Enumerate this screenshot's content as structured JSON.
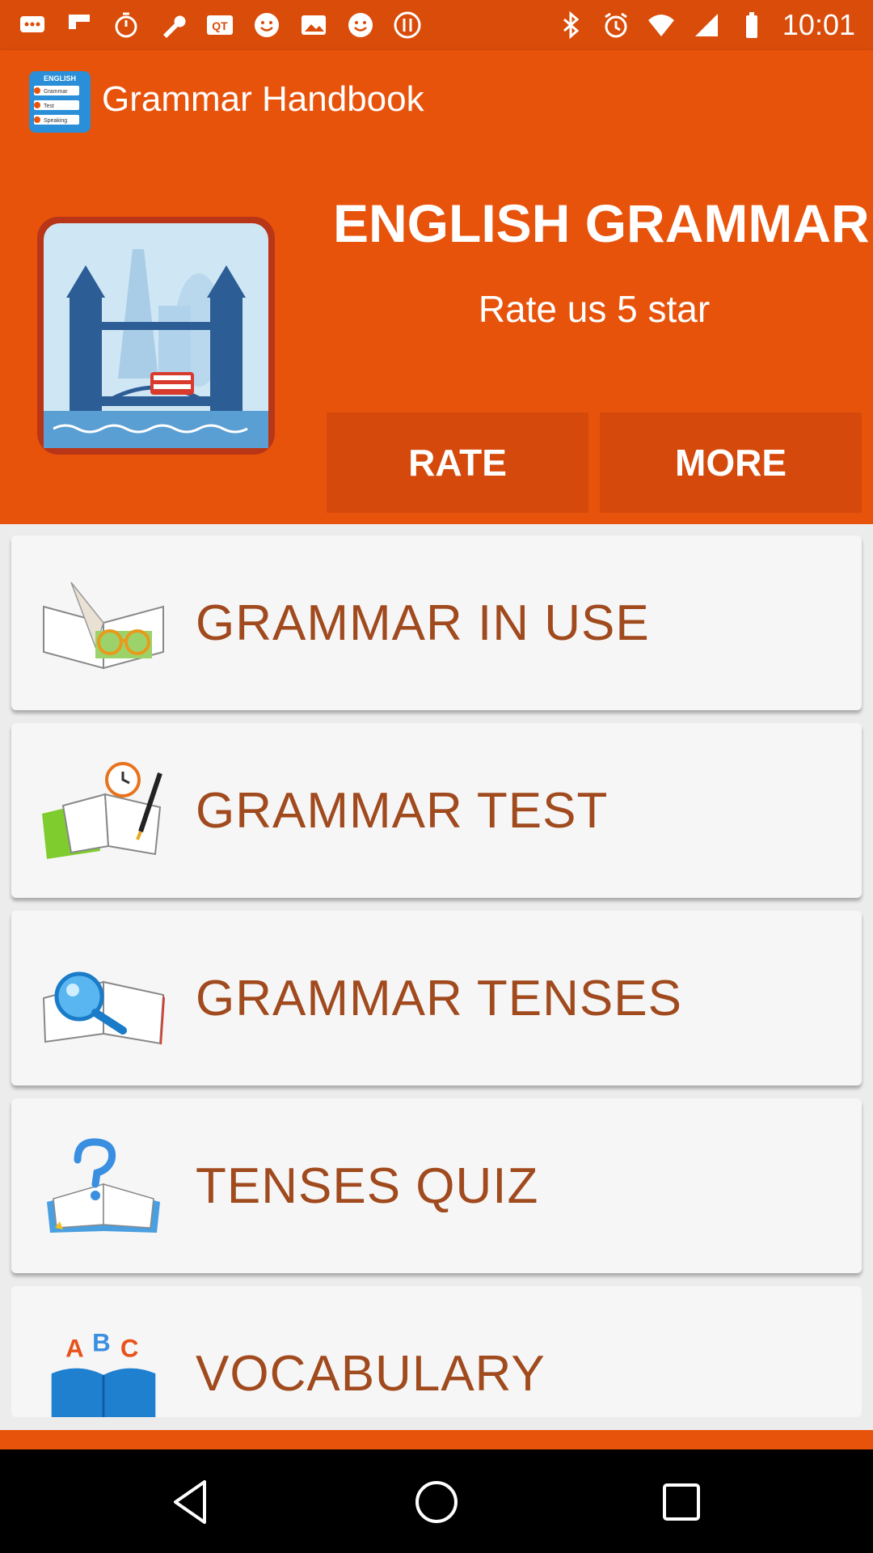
{
  "status_bar": {
    "time": "10:01",
    "left_icons": [
      "messages-icon",
      "flipboard-icon",
      "timer-icon",
      "wrench-icon",
      "qr-app-icon",
      "emoji-icon",
      "image-icon",
      "emoji-icon",
      "data-icon"
    ],
    "right_icons": [
      "bluetooth-icon",
      "alarm-icon",
      "wifi-icon",
      "signal-icon",
      "battery-icon"
    ]
  },
  "app_bar": {
    "title": "Grammar Handbook",
    "logo": {
      "heading": "ENGLISH",
      "lines": [
        "Grammar",
        "Test",
        "Speaking"
      ]
    }
  },
  "banner": {
    "title": "ENGLISH GRAMMAR",
    "subtitle": "Rate us 5 star",
    "rate_label": "RATE",
    "more_label": "MORE"
  },
  "menu": [
    {
      "label": "GRAMMAR IN USE",
      "icon": "book-glasses-icon"
    },
    {
      "label": "GRAMMAR TEST",
      "icon": "book-clock-pen-icon"
    },
    {
      "label": "GRAMMAR TENSES",
      "icon": "book-magnifier-icon"
    },
    {
      "label": "TENSES QUIZ",
      "icon": "book-question-icon"
    },
    {
      "label": "VOCABULARY",
      "icon": "abc-book-icon",
      "icon_text": "ABC"
    }
  ],
  "colors": {
    "status_bar": "#d94c0a",
    "primary": "#e8530c",
    "button": "#d54a0c",
    "menu_text": "#a04a1e",
    "card": "#f6f6f6"
  },
  "nav_bar": {
    "buttons": [
      "back-icon",
      "home-icon",
      "recents-icon"
    ]
  }
}
